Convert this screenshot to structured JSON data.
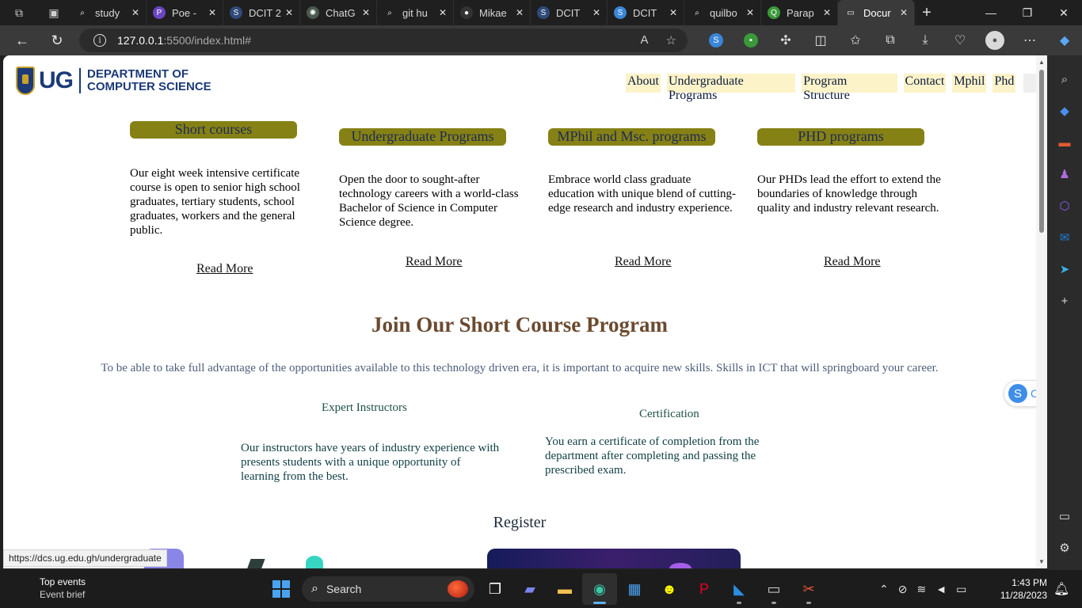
{
  "browser": {
    "tabs": [
      {
        "label": "study",
        "icon": "search-icon",
        "color": "#1f1f1f",
        "glyph": "⌕",
        "active": false
      },
      {
        "label": "Poe -",
        "icon": "poe-icon",
        "color": "#6b46c1",
        "glyph": "P",
        "active": false
      },
      {
        "label": "DCIT 2",
        "icon": "dcit-icon",
        "color": "#2f4a7a",
        "glyph": "S",
        "active": false
      },
      {
        "label": "ChatG",
        "icon": "chatgpt-icon",
        "color": "#4a5a4f",
        "glyph": "✺",
        "active": false
      },
      {
        "label": "git hu",
        "icon": "search-icon",
        "color": "#1f1f1f",
        "glyph": "⌕",
        "active": false
      },
      {
        "label": "Mikae",
        "icon": "github-icon",
        "color": "#333333",
        "glyph": "●",
        "active": false
      },
      {
        "label": "DCIT",
        "icon": "dcit-icon",
        "color": "#2f4a7a",
        "glyph": "S",
        "active": false
      },
      {
        "label": "DCIT",
        "icon": "dcit-icon",
        "color": "#3a86d8",
        "glyph": "S",
        "active": false
      },
      {
        "label": "quilbo",
        "icon": "search-icon",
        "color": "#1f1f1f",
        "glyph": "⌕",
        "active": false
      },
      {
        "label": "Parap",
        "icon": "quillbot-icon",
        "color": "#3a9a3a",
        "glyph": "Q",
        "active": false
      },
      {
        "label": "Docur",
        "icon": "document-icon",
        "color": "#3a3a3a",
        "glyph": "▭",
        "active": true
      }
    ],
    "url_host": "127.0.0.1",
    "url_path": ":5500/index.html#",
    "status_url": "https://dcs.ug.edu.gh/undergraduate"
  },
  "site": {
    "logo_mark": "UG",
    "logo_line1": "DEPARTMENT OF",
    "logo_line2": "COMPUTER SCIENCE",
    "nav": [
      "About",
      "Undergraduate Programs",
      "Program Structure",
      "Contact",
      "Mphil",
      "Phd"
    ],
    "cards": [
      {
        "title": "Short courses",
        "text": "Our eight week intensive certificate course is open to senior high school graduates, tertiary students, school graduates, workers and the general public.",
        "more": "Read More"
      },
      {
        "title": "Undergraduate Programs",
        "text": "Open the door to sought-after technology careers with a world-class Bachelor of Science in Computer Science degree.",
        "more": "Read More"
      },
      {
        "title": "MPhil and Msc. programs",
        "text": "Embrace world class graduate education with unique blend of cutting-edge research and industry experience.",
        "more": "Read More"
      },
      {
        "title": "PHD programs",
        "text": "Our PHDs lead the effort to extend the boundaries of knowledge through quality and industry relevant research.",
        "more": "Read More"
      }
    ],
    "join_title": "Join Our Short Course Program",
    "join_sub": "To be able to take full advantage of the opportunities available to this technology driven era, it is important to acquire new skills. Skills in ICT that will springboard your career.",
    "features": [
      {
        "title": "Expert Instructors",
        "text": "Our instructors have years of industry experience with presents students with a unique opportunity of learning from the best."
      },
      {
        "title": "Certification",
        "text": "You earn a certificate of completion from the department after completing and passing the prescribed exam."
      }
    ],
    "register": "Register",
    "widget_letter": "S",
    "widget_text": "C"
  },
  "taskbar": {
    "widget_title": "Top events",
    "widget_sub": "Event brief",
    "search_label": "Search",
    "time": "1:43 PM",
    "date": "11/28/2023"
  }
}
